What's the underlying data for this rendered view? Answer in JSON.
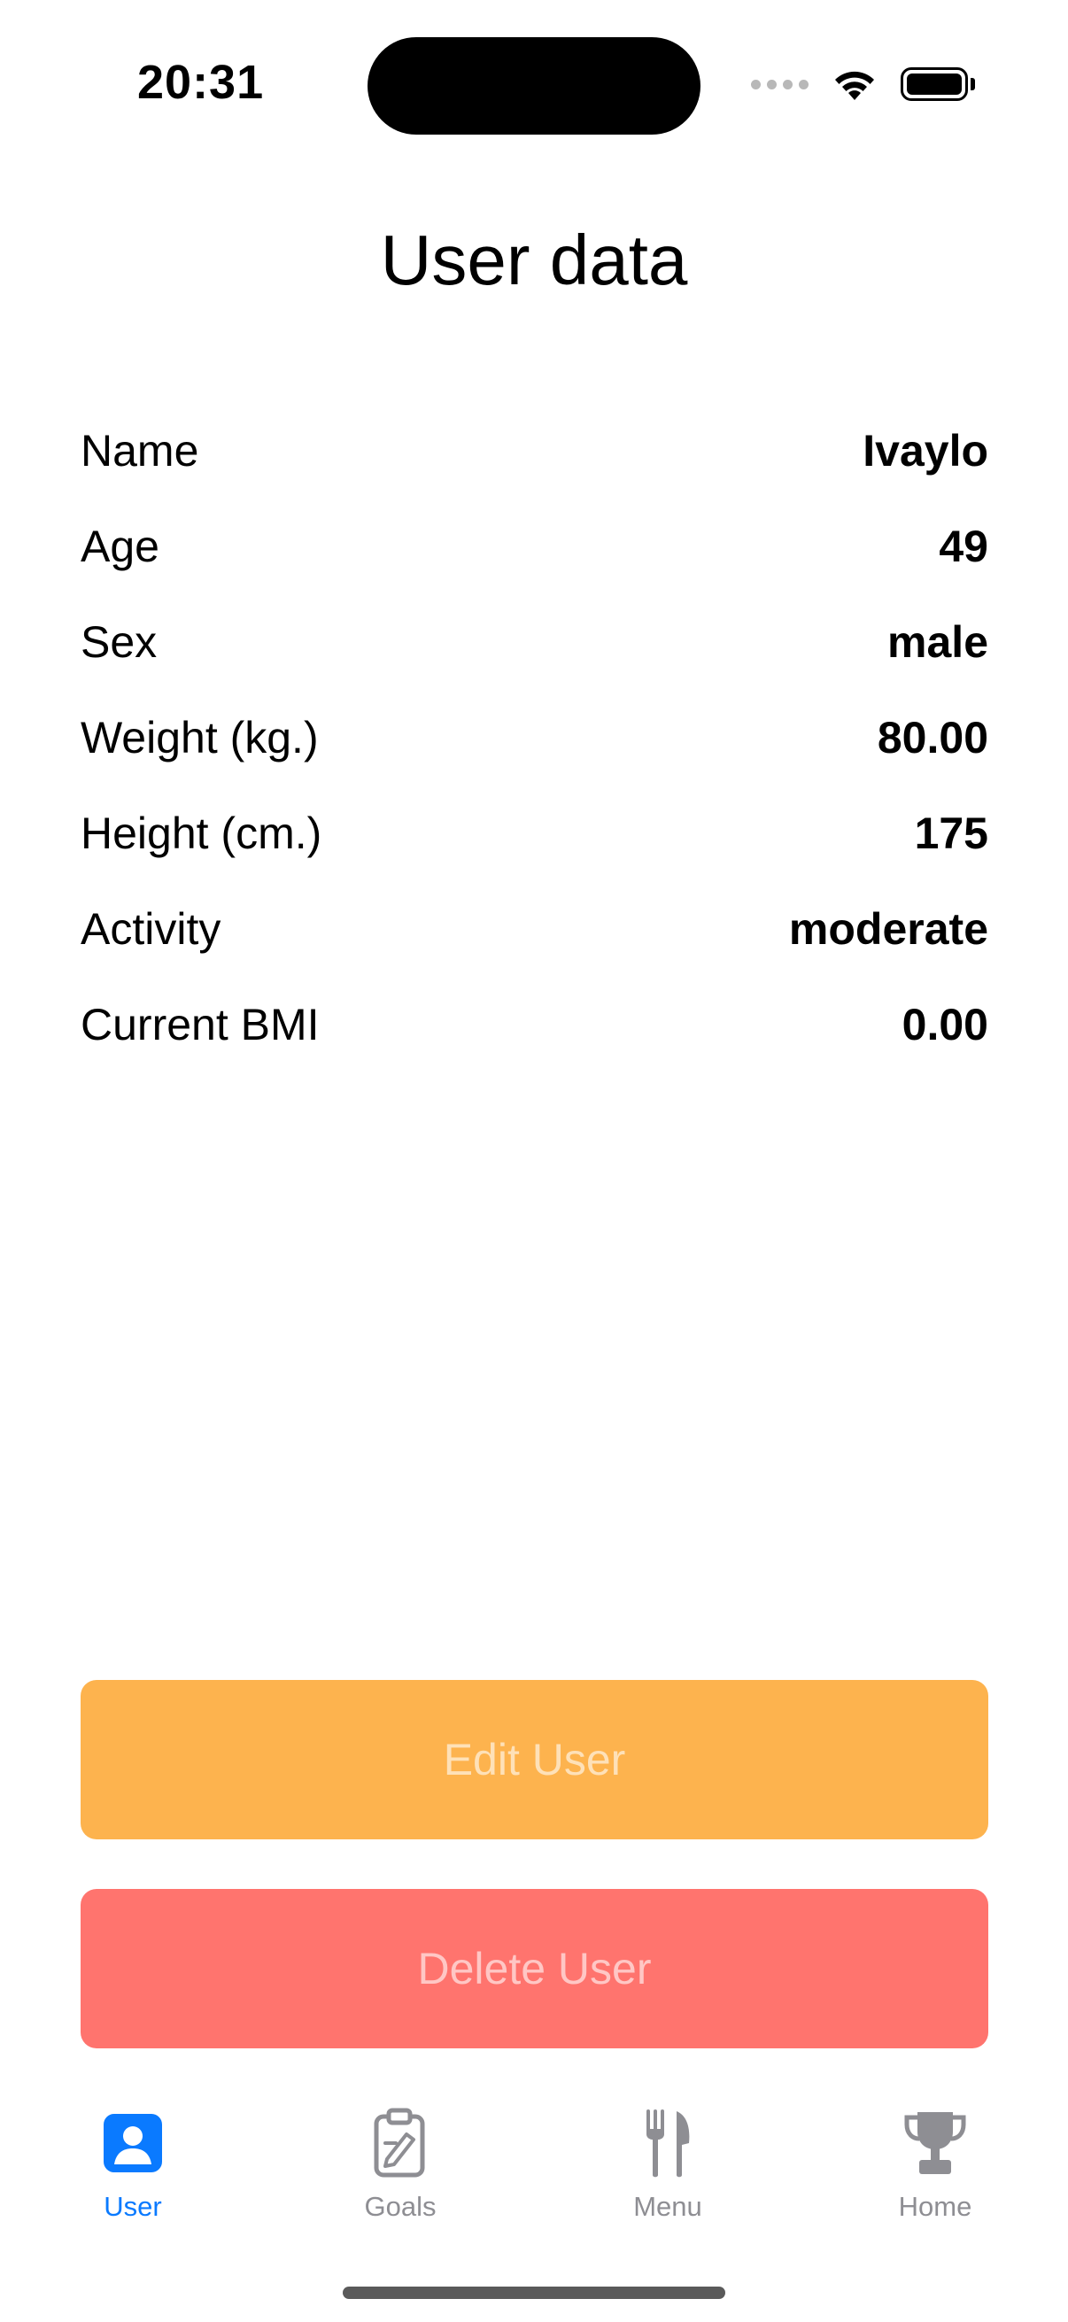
{
  "status_bar": {
    "time": "20:31"
  },
  "page": {
    "title": "User data"
  },
  "user_info": [
    {
      "label": "Name",
      "value": "Ivaylo"
    },
    {
      "label": "Age",
      "value": "49"
    },
    {
      "label": "Sex",
      "value": "male"
    },
    {
      "label": "Weight (kg.)",
      "value": "80.00"
    },
    {
      "label": "Height (cm.)",
      "value": "175"
    },
    {
      "label": "Activity",
      "value": "moderate"
    },
    {
      "label": "Current BMI",
      "value": "0.00"
    }
  ],
  "buttons": {
    "edit_label": "Edit User",
    "delete_label": "Delete User",
    "edit_color": "#FDB34E",
    "delete_color": "#FF746E"
  },
  "tab_bar": {
    "active_color": "#0A7AFF",
    "inactive_color": "#8E8E93",
    "tabs": [
      {
        "label": "User",
        "icon": "person-icon",
        "active": true
      },
      {
        "label": "Goals",
        "icon": "clipboard-icon",
        "active": false
      },
      {
        "label": "Menu",
        "icon": "fork-knife-icon",
        "active": false
      },
      {
        "label": "Home",
        "icon": "trophy-icon",
        "active": false
      }
    ]
  }
}
